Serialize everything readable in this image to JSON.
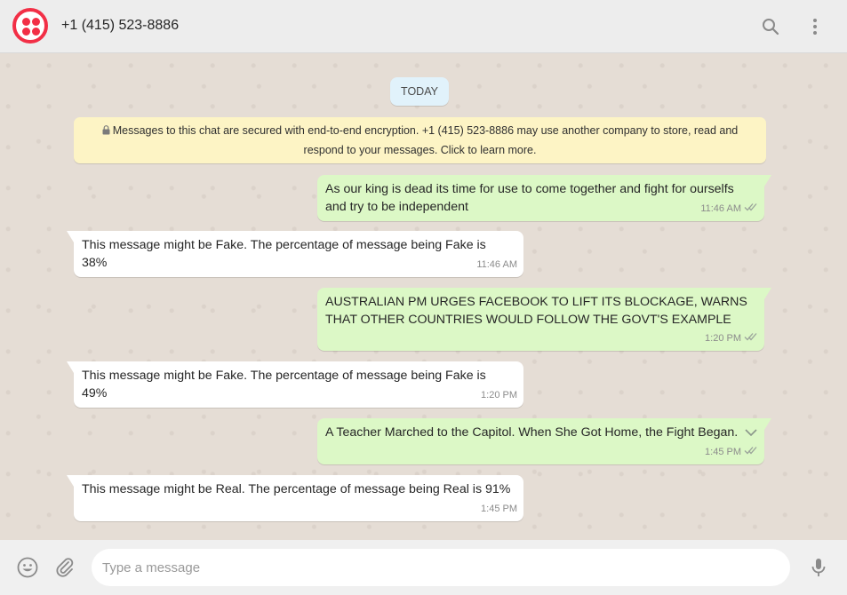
{
  "header": {
    "contact_name": "+1 (415) 523-8886",
    "avatar_icon": "twilio-logo-icon",
    "search_icon": "search-icon",
    "menu_icon": "more-vertical-icon"
  },
  "chat": {
    "date_chip": "TODAY",
    "encryption_notice": "Messages to this chat are secured with end-to-end encryption. +1 (415) 523-8886 may use another company to store, read and respond to your messages. Click to learn more.",
    "messages": [
      {
        "direction": "out",
        "text": "As our king is dead its time for use to come together and fight for ourselfs and try to be independent",
        "time": "11:46 AM",
        "status": "read"
      },
      {
        "direction": "in",
        "text": "This message might be Fake. The percentage of message being Fake is 38%",
        "time": "11:46 AM"
      },
      {
        "direction": "out",
        "text": "AUSTRALIAN PM URGES FACEBOOK TO LIFT ITS BLOCKAGE, WARNS THAT OTHER COUNTRIES WOULD FOLLOW THE GOVT'S EXAMPLE",
        "time": "1:20 PM",
        "status": "read"
      },
      {
        "direction": "in",
        "text": "This message might be Fake. The percentage of message being Fake is 49%",
        "time": "1:20 PM"
      },
      {
        "direction": "out",
        "text": "A Teacher Marched to the Capitol. When She Got Home, the Fight Began.",
        "time": "1:45 PM",
        "status": "read"
      },
      {
        "direction": "in",
        "text": "This message might be Real. The percentage of message being Real is 91%",
        "time": "1:45 PM"
      }
    ]
  },
  "footer": {
    "input_placeholder": "Type a message",
    "input_value": "",
    "emoji_icon": "emoji-icon",
    "attach_icon": "paperclip-icon",
    "mic_icon": "microphone-icon"
  },
  "colors": {
    "chat_background": "#e5ddd5",
    "outgoing_bubble": "#dcf8c6",
    "incoming_bubble": "#ffffff",
    "notice_background": "#fdf4c5",
    "date_chip_background": "#e1f2fb",
    "brand_red": "#f22f46"
  }
}
